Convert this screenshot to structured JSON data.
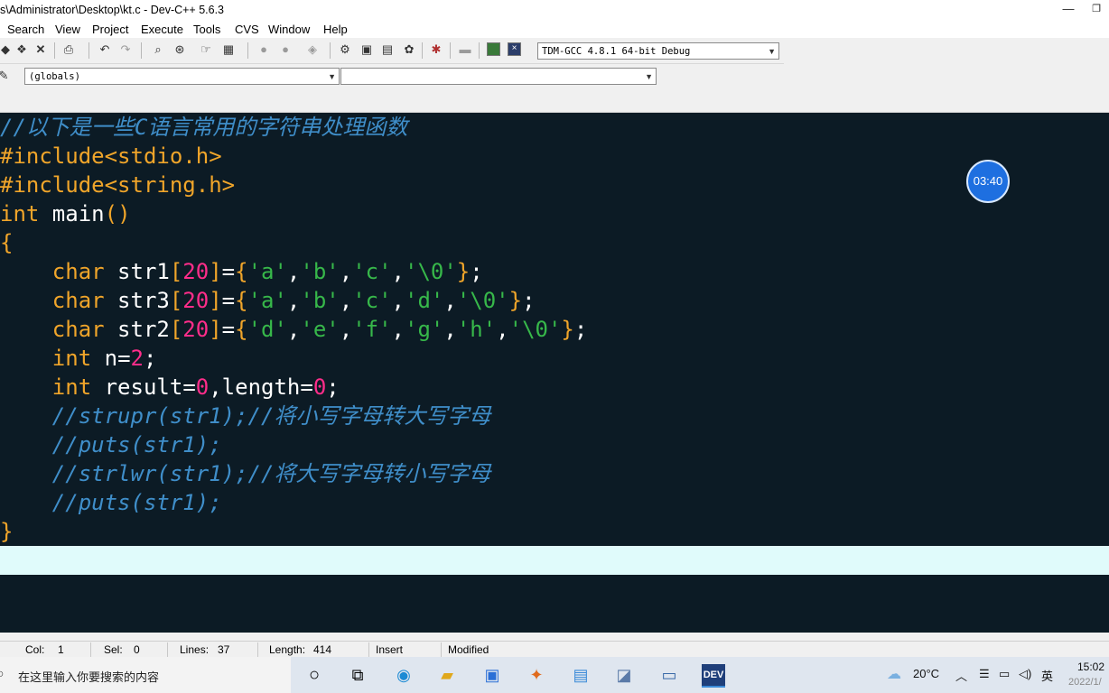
{
  "window": {
    "title": "s\\Administrator\\Desktop\\kt.c - Dev-C++ 5.6.3",
    "minimize_glyph": "—",
    "restore_glyph": "❐"
  },
  "menu": [
    "Search",
    "View",
    "Project",
    "Execute",
    "Tools",
    "CVS",
    "Window",
    "Help"
  ],
  "toolbar": {
    "compiler_select": "TDM-GCC 4.8.1 64-bit Debug",
    "scope_select": "(globals)",
    "member_select": ""
  },
  "code_lines": [
    "//以下是一些C语言常用的字符串处理函数",
    "#include<stdio.h>",
    "#include<string.h>",
    "int main()",
    "{",
    "    char str1[20]={'a','b','c','\\0'};",
    "    char str3[20]={'a','b','c','d','\\0'};",
    "    char str2[20]={'d','e','f','g','h','\\0'};",
    "    int n=2;",
    "    int result=0,length=0;",
    "    //strupr(str1);//将小写字母转大写字母",
    "    //puts(str1);",
    "    //strlwr(str1);//将大写字母转小写字母",
    "    //puts(str1);",
    "}"
  ],
  "overlay": {
    "timer": "03:40"
  },
  "status": {
    "col_label": "Col:",
    "col_value": "1",
    "sel_label": "Sel:",
    "sel_value": "0",
    "lines_label": "Lines:",
    "lines_value": "37",
    "length_label": "Length:",
    "length_value": "414",
    "mode": "Insert",
    "state": "Modified"
  },
  "taskbar": {
    "search_placeholder": "在这里输入你要搜索的内容",
    "weather": "20°C",
    "ime": "英",
    "time": "15:02",
    "date": "2022/1/"
  },
  "colors": {
    "editor_bg": "#0c1b25",
    "comment": "#3f8ec9",
    "keyword": "#f0a52a",
    "number": "#ff2d8a",
    "char_literal": "#37b84a",
    "current_line": "#e0fbfb"
  }
}
